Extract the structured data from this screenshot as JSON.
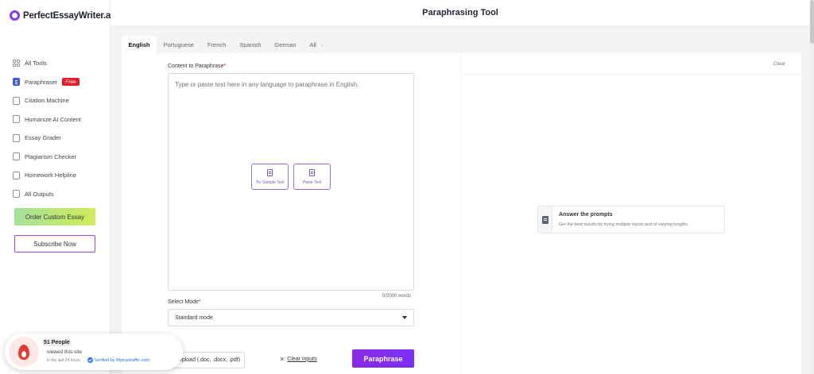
{
  "brand": {
    "name": "PerfectEssayWriter.ai"
  },
  "header": {
    "title": "Paraphrasing Tool"
  },
  "sidebar": {
    "items": [
      {
        "label": "All Tools",
        "icon": "grid-icon"
      },
      {
        "label": "Paraphraser",
        "icon": "document-icon",
        "badge": "Free"
      },
      {
        "label": "Citation Machine",
        "icon": "citation-icon"
      },
      {
        "label": "Humanize AI Content",
        "icon": "humanize-icon"
      },
      {
        "label": "Essay Grader",
        "icon": "grader-icon"
      },
      {
        "label": "Plagiarism Checker",
        "icon": "plagiarism-icon"
      },
      {
        "label": "Homework Helpline",
        "icon": "chat-icon"
      },
      {
        "label": "All Outputs",
        "icon": "outputs-icon"
      }
    ],
    "order_button": "Order Custom Essay",
    "subscribe_button": "Subscribe Now"
  },
  "tabs": [
    {
      "label": "English",
      "active": true
    },
    {
      "label": "Portuguese"
    },
    {
      "label": "French"
    },
    {
      "label": "Spanish"
    },
    {
      "label": "German"
    },
    {
      "label": "All"
    }
  ],
  "editor": {
    "content_label": "Content to Paraphrase",
    "required_mark": "*",
    "placeholder": "Type or paste text here in any language to paraphrase in English.",
    "sample_button": "Try Sample Text",
    "paste_button": "Paste Text",
    "word_count": "0/2000 words",
    "mode_label": "Select Mode",
    "mode_value": "Standard mode",
    "upload_button": "Upload (.doc, .docx, .pdf)",
    "clear_inputs": "Clear inputs",
    "paraphrase_button": "Paraphrase"
  },
  "output": {
    "clear_label": "Clear",
    "prompt_title": "Answer the prompts",
    "prompt_subtitle": "Get the best results by trying multiple inputs and of varying lengths."
  },
  "social_proof": {
    "count": "51 People",
    "text": "viewed this site",
    "time": "in the last 24 hours",
    "verified": "Verified by Mytrustraffic.com"
  },
  "colors": {
    "accent": "#8a2be2",
    "badge": "#e11d2a",
    "verified": "#1e73e8"
  }
}
